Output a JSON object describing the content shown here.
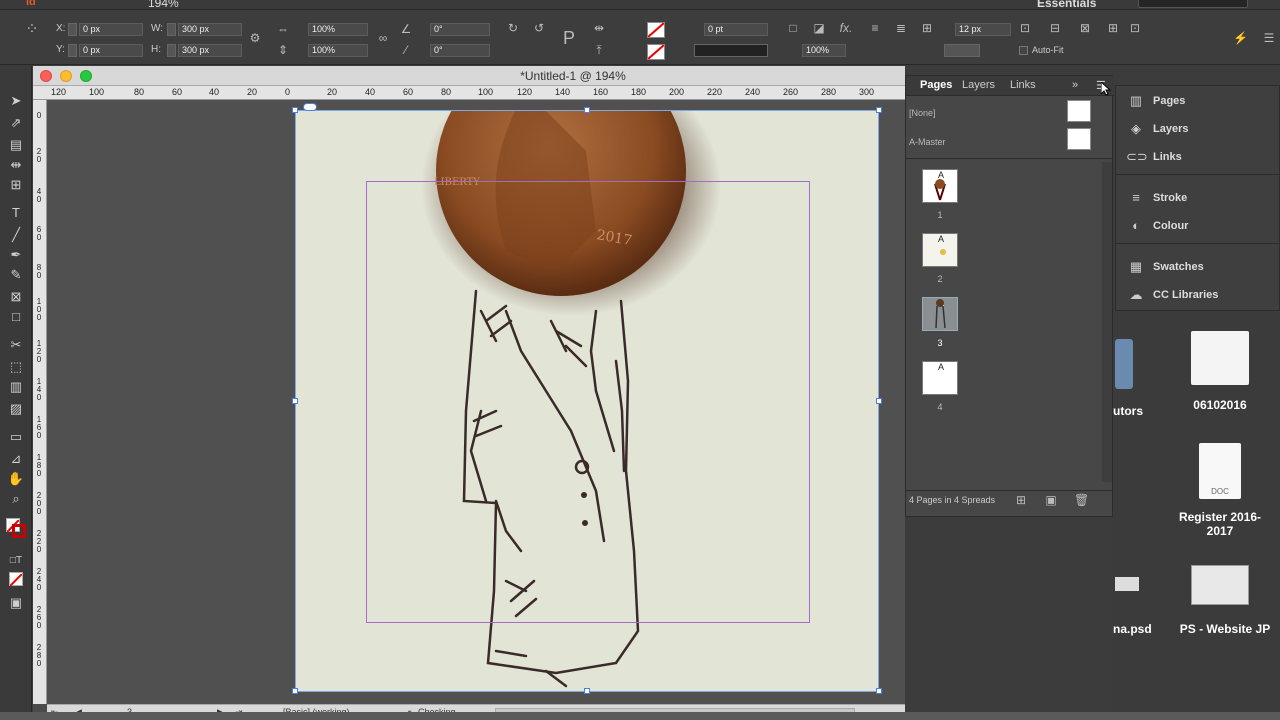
{
  "app": {
    "zoom_menu": "194%",
    "workspace": "Essentials"
  },
  "control_bar": {
    "x_label": "X:",
    "x_value": "0 px",
    "y_label": "Y:",
    "y_value": "0 px",
    "w_label": "W:",
    "w_value": "300 px",
    "h_label": "H:",
    "h_value": "300 px",
    "scale_x": "100%",
    "scale_y": "100%",
    "scale_x2": "100%",
    "scale_y2": "100%",
    "rotate": "0°",
    "shear": "0°",
    "stroke_weight": "0 pt",
    "opacity": "100%",
    "gutter": "12 px",
    "auto_fit": "Auto-Fit"
  },
  "document": {
    "title": "*Untitled-1 @ 194%",
    "ruler_h": [
      "120",
      "100",
      "80",
      "60",
      "40",
      "20",
      "0",
      "20",
      "40",
      "60",
      "80",
      "100",
      "120",
      "140",
      "160",
      "180",
      "200",
      "220",
      "240",
      "260",
      "280",
      "300"
    ],
    "ruler_v": [
      "0",
      "2 0",
      "4 0",
      "6 0",
      "8 0",
      "1 0 0",
      "1 2 0",
      "1 4 0",
      "1 6 0",
      "1 8 0",
      "2 0 0",
      "2 2 0",
      "2 4 0",
      "2 6 0",
      "2 8 0"
    ],
    "coin_year": "2017",
    "coin_word": "LIBERTY",
    "status_page": "3",
    "status_style": "[Basic] (working)",
    "status_preflight": "Checking"
  },
  "pages_panel": {
    "tabs": [
      "Pages",
      "Layers",
      "Links"
    ],
    "masters": [
      "[None]",
      "A-Master"
    ],
    "pages": [
      {
        "label": "1",
        "prefix": "A"
      },
      {
        "label": "2",
        "prefix": "A"
      },
      {
        "label": "3",
        "prefix": "A"
      },
      {
        "label": "4",
        "prefix": "A"
      }
    ],
    "footer": "4 Pages in 4 Spreads"
  },
  "dock": {
    "items": [
      "Pages",
      "Layers",
      "Links",
      "Stroke",
      "Colour",
      "Swatches",
      "CC Libraries"
    ]
  },
  "desktop": {
    "items": [
      "utors",
      "06102016",
      "Register 2016-2017",
      "DOC",
      "na.psd",
      "PS - Website JP"
    ]
  },
  "colors": {
    "selection": "#4a7fe0",
    "margin_guide": "#a46cc8",
    "coin": "#8a4b22"
  }
}
